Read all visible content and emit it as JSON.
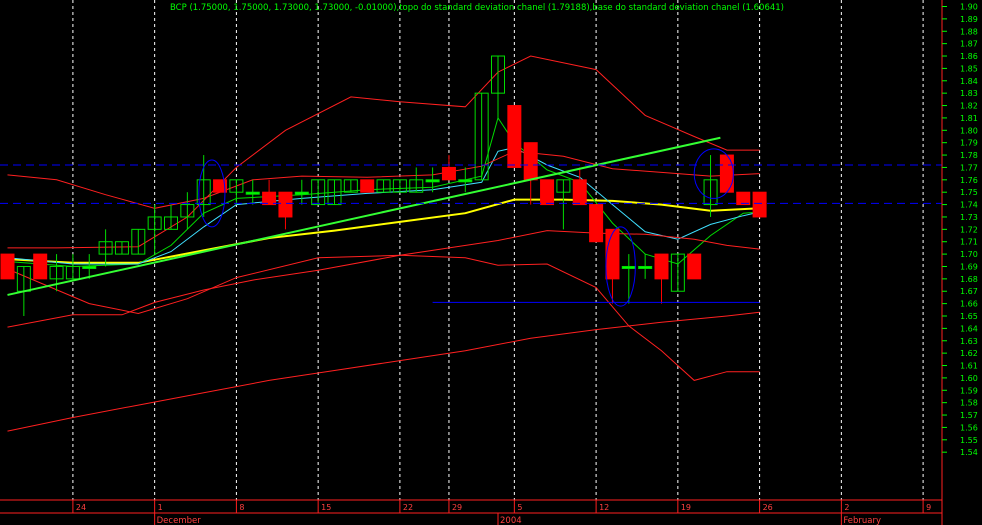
{
  "chart_data": {
    "type": "candlestick",
    "title": "BCP (1.75000, 1.75000, 1.73000, 1.73000, -0.01000),topo do standard deviation chanel (1.79188),base do standard deviation chanel (1.60641)",
    "ylim": [
      1.532,
      1.908
    ],
    "y_ticks": [
      1.9,
      1.89,
      1.88,
      1.87,
      1.86,
      1.85,
      1.84,
      1.83,
      1.82,
      1.81,
      1.8,
      1.79,
      1.78,
      1.77,
      1.76,
      1.75,
      1.74,
      1.73,
      1.72,
      1.71,
      1.7,
      1.69,
      1.68,
      1.67,
      1.66,
      1.65,
      1.64,
      1.63,
      1.62,
      1.61,
      1.6,
      1.59,
      1.58,
      1.57,
      1.56,
      1.55,
      1.54
    ],
    "x_ticks": [
      {
        "label": "24",
        "i": 4
      },
      {
        "label": "1",
        "i": 9
      },
      {
        "label": "8",
        "i": 14
      },
      {
        "label": "15",
        "i": 19
      },
      {
        "label": "22",
        "i": 24
      },
      {
        "label": "29",
        "i": 27
      },
      {
        "label": "5",
        "i": 31
      },
      {
        "label": "12",
        "i": 36
      },
      {
        "label": "19",
        "i": 41
      },
      {
        "label": "26",
        "i": 46
      },
      {
        "label": "2",
        "i": 51
      },
      {
        "label": "9",
        "i": 56
      }
    ],
    "months": [
      {
        "label": "December",
        "i": 9
      },
      {
        "label": "2004",
        "i": 30
      },
      {
        "label": "February",
        "i": 51
      }
    ],
    "candles": [
      {
        "o": 1.7,
        "h": 1.7,
        "l": 1.68,
        "c": 1.68
      },
      {
        "o": 1.67,
        "h": 1.69,
        "l": 1.65,
        "c": 1.69
      },
      {
        "o": 1.7,
        "h": 1.7,
        "l": 1.68,
        "c": 1.68
      },
      {
        "o": 1.68,
        "h": 1.7,
        "l": 1.67,
        "c": 1.69
      },
      {
        "o": 1.68,
        "h": 1.7,
        "l": 1.68,
        "c": 1.69
      },
      {
        "o": 1.69,
        "h": 1.7,
        "l": 1.68,
        "c": 1.69
      },
      {
        "o": 1.7,
        "h": 1.72,
        "l": 1.69,
        "c": 1.71
      },
      {
        "o": 1.7,
        "h": 1.71,
        "l": 1.7,
        "c": 1.71
      },
      {
        "o": 1.7,
        "h": 1.72,
        "l": 1.7,
        "c": 1.72
      },
      {
        "o": 1.72,
        "h": 1.74,
        "l": 1.7,
        "c": 1.73
      },
      {
        "o": 1.72,
        "h": 1.74,
        "l": 1.72,
        "c": 1.73
      },
      {
        "o": 1.73,
        "h": 1.75,
        "l": 1.72,
        "c": 1.74
      },
      {
        "o": 1.74,
        "h": 1.78,
        "l": 1.73,
        "c": 1.76
      },
      {
        "o": 1.76,
        "h": 1.76,
        "l": 1.75,
        "c": 1.75
      },
      {
        "o": 1.75,
        "h": 1.76,
        "l": 1.74,
        "c": 1.76
      },
      {
        "o": 1.75,
        "h": 1.76,
        "l": 1.74,
        "c": 1.75
      },
      {
        "o": 1.75,
        "h": 1.76,
        "l": 1.74,
        "c": 1.74
      },
      {
        "o": 1.75,
        "h": 1.75,
        "l": 1.72,
        "c": 1.73
      },
      {
        "o": 1.75,
        "h": 1.76,
        "l": 1.74,
        "c": 1.75
      },
      {
        "o": 1.74,
        "h": 1.76,
        "l": 1.74,
        "c": 1.76
      },
      {
        "o": 1.74,
        "h": 1.76,
        "l": 1.74,
        "c": 1.76
      },
      {
        "o": 1.75,
        "h": 1.76,
        "l": 1.75,
        "c": 1.76
      },
      {
        "o": 1.76,
        "h": 1.76,
        "l": 1.75,
        "c": 1.75
      },
      {
        "o": 1.75,
        "h": 1.76,
        "l": 1.75,
        "c": 1.76
      },
      {
        "o": 1.75,
        "h": 1.76,
        "l": 1.75,
        "c": 1.76
      },
      {
        "o": 1.75,
        "h": 1.77,
        "l": 1.75,
        "c": 1.76
      },
      {
        "o": 1.76,
        "h": 1.77,
        "l": 1.75,
        "c": 1.76
      },
      {
        "o": 1.77,
        "h": 1.78,
        "l": 1.76,
        "c": 1.76
      },
      {
        "o": 1.76,
        "h": 1.77,
        "l": 1.75,
        "c": 1.76
      },
      {
        "o": 1.76,
        "h": 1.83,
        "l": 1.76,
        "c": 1.83
      },
      {
        "o": 1.83,
        "h": 1.86,
        "l": 1.81,
        "c": 1.86
      },
      {
        "o": 1.82,
        "h": 1.82,
        "l": 1.77,
        "c": 1.77
      },
      {
        "o": 1.79,
        "h": 1.79,
        "l": 1.74,
        "c": 1.76
      },
      {
        "o": 1.76,
        "h": 1.76,
        "l": 1.74,
        "c": 1.74
      },
      {
        "o": 1.75,
        "h": 1.76,
        "l": 1.72,
        "c": 1.76
      },
      {
        "o": 1.76,
        "h": 1.77,
        "l": 1.74,
        "c": 1.74
      },
      {
        "o": 1.74,
        "h": 1.74,
        "l": 1.71,
        "c": 1.71
      },
      {
        "o": 1.72,
        "h": 1.72,
        "l": 1.66,
        "c": 1.68
      },
      {
        "o": 1.69,
        "h": 1.7,
        "l": 1.66,
        "c": 1.69
      },
      {
        "o": 1.69,
        "h": 1.7,
        "l": 1.68,
        "c": 1.69
      },
      {
        "o": 1.7,
        "h": 1.7,
        "l": 1.66,
        "c": 1.68
      },
      {
        "o": 1.67,
        "h": 1.7,
        "l": 1.67,
        "c": 1.7
      },
      {
        "o": 1.7,
        "h": 1.7,
        "l": 1.68,
        "c": 1.68
      },
      {
        "o": 1.74,
        "h": 1.78,
        "l": 1.73,
        "c": 1.76
      },
      {
        "o": 1.78,
        "h": 1.78,
        "l": 1.75,
        "c": 1.75
      },
      {
        "o": 1.75,
        "h": 1.75,
        "l": 1.74,
        "c": 1.74
      },
      {
        "o": 1.75,
        "h": 1.75,
        "l": 1.73,
        "c": 1.73
      }
    ],
    "overlays": {
      "sma_yellow": {
        "color": "#ffff00",
        "points": [
          [
            0,
            1.696
          ],
          [
            4,
            1.693
          ],
          [
            8,
            1.693
          ],
          [
            12,
            1.703
          ],
          [
            16,
            1.713
          ],
          [
            20,
            1.719
          ],
          [
            24,
            1.726
          ],
          [
            28,
            1.733
          ],
          [
            31,
            1.744
          ],
          [
            34,
            1.744
          ],
          [
            37,
            1.743
          ],
          [
            40,
            1.74
          ],
          [
            43,
            1.735
          ],
          [
            46,
            1.737
          ]
        ]
      },
      "ema_green": {
        "color": "#00dd00",
        "points": [
          [
            0,
            1.694
          ],
          [
            4,
            1.69
          ],
          [
            8,
            1.692
          ],
          [
            10,
            1.707
          ],
          [
            12,
            1.733
          ],
          [
            14,
            1.745
          ],
          [
            18,
            1.748
          ],
          [
            22,
            1.752
          ],
          [
            26,
            1.754
          ],
          [
            29,
            1.763
          ],
          [
            30,
            1.81
          ],
          [
            31,
            1.79
          ],
          [
            33,
            1.768
          ],
          [
            35,
            1.758
          ],
          [
            37,
            1.725
          ],
          [
            39,
            1.7
          ],
          [
            41,
            1.692
          ],
          [
            43,
            1.715
          ],
          [
            45,
            1.733
          ],
          [
            46,
            1.734
          ]
        ]
      },
      "ema_cyan": {
        "color": "#40e0ff",
        "points": [
          [
            0,
            1.697
          ],
          [
            4,
            1.692
          ],
          [
            8,
            1.692
          ],
          [
            10,
            1.702
          ],
          [
            12,
            1.722
          ],
          [
            14,
            1.74
          ],
          [
            18,
            1.745
          ],
          [
            22,
            1.749
          ],
          [
            26,
            1.752
          ],
          [
            29,
            1.758
          ],
          [
            30,
            1.783
          ],
          [
            31,
            1.786
          ],
          [
            33,
            1.772
          ],
          [
            35,
            1.762
          ],
          [
            37,
            1.74
          ],
          [
            39,
            1.718
          ],
          [
            41,
            1.712
          ],
          [
            43,
            1.724
          ],
          [
            45,
            1.731
          ],
          [
            46,
            1.734
          ]
        ]
      },
      "boll_upper": {
        "color": "#ff2020",
        "points": [
          [
            0,
            1.705
          ],
          [
            3,
            1.705
          ],
          [
            8,
            1.706
          ],
          [
            11,
            1.73
          ],
          [
            14,
            1.77
          ],
          [
            17,
            1.8
          ],
          [
            21,
            1.827
          ],
          [
            24,
            1.823
          ],
          [
            28,
            1.819
          ],
          [
            30,
            1.847
          ],
          [
            32,
            1.86
          ],
          [
            36,
            1.849
          ],
          [
            39,
            1.812
          ],
          [
            42,
            1.795
          ],
          [
            44,
            1.784
          ],
          [
            46,
            1.784
          ]
        ]
      },
      "boll_lower": {
        "color": "#ff2020",
        "points": [
          [
            0,
            1.688
          ],
          [
            5,
            1.66
          ],
          [
            8,
            1.652
          ],
          [
            11,
            1.664
          ],
          [
            14,
            1.681
          ],
          [
            19,
            1.697
          ],
          [
            24,
            1.699
          ],
          [
            28,
            1.697
          ],
          [
            30,
            1.691
          ],
          [
            33,
            1.692
          ],
          [
            36,
            1.673
          ],
          [
            38,
            1.642
          ],
          [
            40,
            1.622
          ],
          [
            42,
            1.598
          ],
          [
            44,
            1.605
          ],
          [
            46,
            1.605
          ]
        ]
      },
      "env_upper": {
        "color": "#ff2020",
        "points": [
          [
            0,
            1.764
          ],
          [
            3,
            1.76
          ],
          [
            6,
            1.748
          ],
          [
            9,
            1.737
          ],
          [
            12,
            1.745
          ],
          [
            15,
            1.76
          ],
          [
            18,
            1.763
          ],
          [
            22,
            1.762
          ],
          [
            26,
            1.764
          ],
          [
            29,
            1.771
          ],
          [
            31,
            1.783
          ],
          [
            34,
            1.779
          ],
          [
            37,
            1.769
          ],
          [
            40,
            1.766
          ],
          [
            43,
            1.763
          ],
          [
            46,
            1.765
          ]
        ]
      },
      "env_lower": {
        "color": "#ff2020",
        "points": [
          [
            0,
            1.641
          ],
          [
            4,
            1.651
          ],
          [
            7,
            1.651
          ],
          [
            9,
            1.661
          ],
          [
            12,
            1.671
          ],
          [
            15,
            1.679
          ],
          [
            19,
            1.687
          ],
          [
            24,
            1.699
          ],
          [
            27,
            1.705
          ],
          [
            30,
            1.711
          ],
          [
            33,
            1.719
          ],
          [
            36,
            1.717
          ],
          [
            39,
            1.716
          ],
          [
            42,
            1.712
          ],
          [
            44,
            1.707
          ],
          [
            46,
            1.704
          ]
        ]
      },
      "long_ma": {
        "color": "#ff2020",
        "points": [
          [
            0,
            1.557
          ],
          [
            4,
            1.568
          ],
          [
            8,
            1.578
          ],
          [
            12,
            1.588
          ],
          [
            16,
            1.598
          ],
          [
            20,
            1.606
          ],
          [
            24,
            1.614
          ],
          [
            28,
            1.622
          ],
          [
            32,
            1.632
          ],
          [
            36,
            1.639
          ],
          [
            40,
            1.645
          ],
          [
            44,
            1.65
          ],
          [
            46,
            1.653
          ]
        ]
      }
    },
    "trendline": {
      "color": "#33ff33",
      "points": [
        [
          0,
          1.667
        ],
        [
          43.6,
          1.794
        ]
      ]
    },
    "hlines": [
      {
        "color": "#0000ff",
        "style": "dashed",
        "y": 1.772
      },
      {
        "color": "#0000ff",
        "style": "dashed",
        "y": 1.741
      },
      {
        "color": "#0000ff",
        "style": "solid",
        "y": 1.661,
        "from": 26,
        "to": 46
      }
    ],
    "ellipses": [
      {
        "color": "#0000ff",
        "cx": 12.5,
        "cy": 1.749,
        "rx": 0.8,
        "ry": 0.027
      },
      {
        "color": "#0000ff",
        "cx": 37.5,
        "cy": 1.69,
        "rx": 0.9,
        "ry": 0.032
      },
      {
        "color": "#0000ff",
        "cx": 43.2,
        "cy": 1.765,
        "rx": 1.2,
        "ry": 0.02
      }
    ],
    "grid": true
  }
}
